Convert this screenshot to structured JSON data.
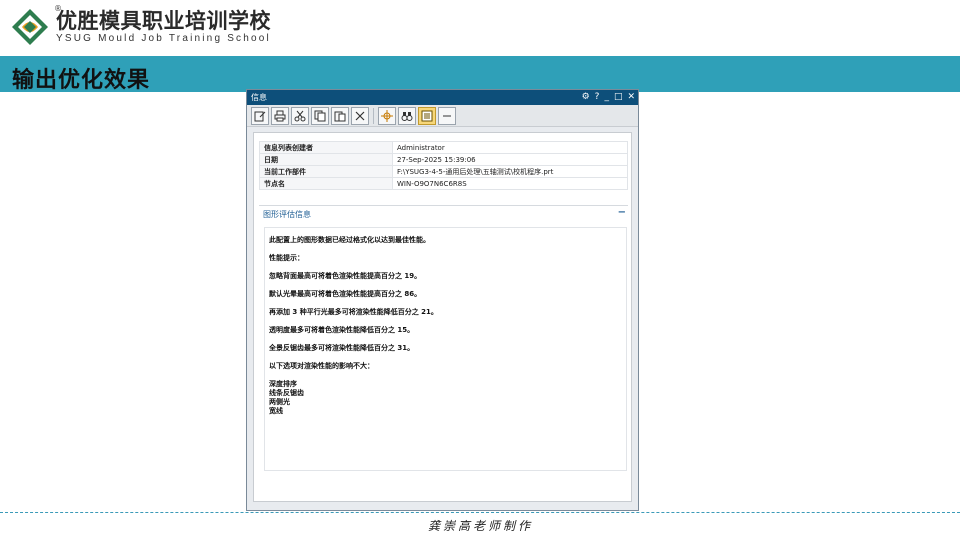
{
  "brand": {
    "cn": "优胜模具职业培训学校",
    "en": "YSUG Mould Job Training School",
    "reg": "®"
  },
  "slide_title": "输出优化效果",
  "dialog": {
    "title": "信息",
    "controls": [
      "⚙",
      "?",
      "_",
      "□",
      "✕"
    ],
    "meta_rows": [
      {
        "key": "信息列表创建者",
        "value": "Administrator"
      },
      {
        "key": "日期",
        "value": "27-Sep-2025 15:39:06"
      },
      {
        "key": "当前工作部件",
        "value": "F:\\YSUG3-4-5-通用后处理\\五轴测试\\校机程序.prt"
      },
      {
        "key": "节点名",
        "value": "WIN-O9O7N6C6R8S"
      }
    ],
    "section_title": "图形评估信息",
    "section_collapse": "−",
    "lines": [
      "此配置上的图形数据已经过格式化以达到最佳性能。",
      "",
      "性能提示：",
      "",
      "忽略背面最高可将着色渲染性能提高百分之 19。",
      "",
      "默认光晕最高可将着色渲染性能提高百分之 86。",
      "",
      "再添加 3 种平行光最多可将渲染性能降低百分之 21。",
      "",
      "透明度最多可将着色渲染性能降低百分之 15。",
      "",
      "全景反锯齿最多可将渲染性能降低百分之 31。",
      "",
      "以下选项对渲染性能的影响不大：",
      "",
      "深度排序",
      "线条反锯齿",
      "两侧光",
      "宽线"
    ]
  },
  "footer": "龚崇高老师制作",
  "colors": {
    "title_bar": "#2fa0b8",
    "dialog_title": "#0d4f7a",
    "section_title": "#1f5e94"
  }
}
